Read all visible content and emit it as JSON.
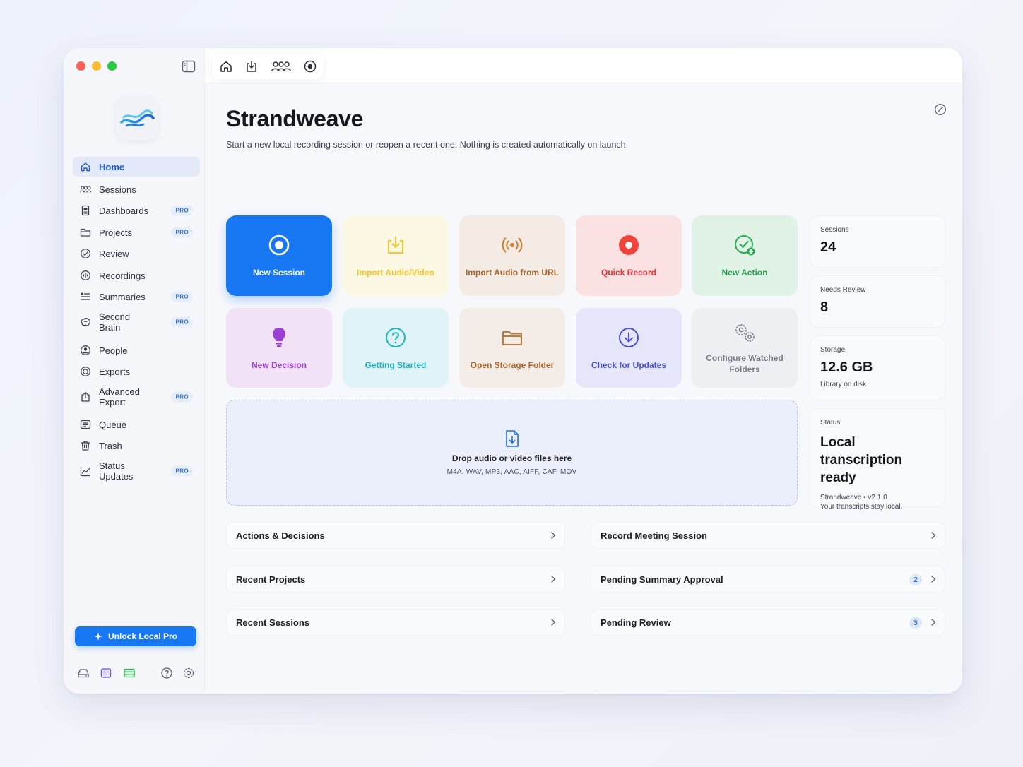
{
  "app": {
    "name": "Strandweave",
    "subtitle": "Start a new local recording session or reopen a recent one. Nothing is created automatically on launch."
  },
  "sidebar": {
    "items": [
      {
        "label": "Home",
        "icon": "home-icon",
        "active": true,
        "pro": false
      },
      {
        "label": "Sessions",
        "icon": "people-group-icon",
        "pro": false
      },
      {
        "label": "Dashboards",
        "icon": "dashboard-icon",
        "pro": true
      },
      {
        "label": "Projects",
        "icon": "folder-icon",
        "pro": true
      },
      {
        "label": "Review",
        "icon": "check-circle-icon",
        "pro": false
      },
      {
        "label": "Recordings",
        "icon": "waveform-icon",
        "pro": false
      },
      {
        "label": "Summaries",
        "icon": "list-icon",
        "pro": true
      },
      {
        "label": "Second Brain",
        "icon": "brain-icon",
        "pro": true
      },
      {
        "label": "People",
        "icon": "person-icon",
        "pro": false
      },
      {
        "label": "Exports",
        "icon": "export-circle-icon",
        "pro": false
      },
      {
        "label": "Advanced Export",
        "icon": "advanced-export-icon",
        "pro": true
      },
      {
        "label": "Queue",
        "icon": "queue-icon",
        "pro": false
      },
      {
        "label": "Trash",
        "icon": "trash-icon",
        "pro": false
      },
      {
        "label": "Status Updates",
        "icon": "chart-line-icon",
        "pro": true
      }
    ],
    "pro_badge": "PRO",
    "unlock_label": "Unlock Local Pro"
  },
  "tiles": [
    {
      "label": "New Session",
      "icon": "record-target-icon"
    },
    {
      "label": "Import Audio/Video",
      "icon": "import-icon"
    },
    {
      "label": "Import Audio from URL",
      "icon": "broadcast-icon"
    },
    {
      "label": "Quick Record",
      "icon": "record-dot-icon"
    },
    {
      "label": "New Action",
      "icon": "check-plus-icon"
    },
    {
      "label": "New Decision",
      "icon": "lightbulb-icon"
    },
    {
      "label": "Getting Started",
      "icon": "question-icon"
    },
    {
      "label": "Open Storage Folder",
      "icon": "folder-icon"
    },
    {
      "label": "Check for Updates",
      "icon": "download-circle-icon"
    },
    {
      "label": "Configure Watched Folders",
      "icon": "gears-icon"
    }
  ],
  "stats": {
    "sessions": {
      "label": "Sessions",
      "value": "24"
    },
    "review": {
      "label": "Needs Review",
      "value": "8"
    },
    "storage": {
      "label": "Storage",
      "value": "12.6 GB",
      "sub": "Library on disk"
    },
    "status": {
      "label": "Status",
      "value": "Local transcription ready",
      "version": "Strandweave • v2.1.0",
      "note": "Your transcripts stay local."
    }
  },
  "drop": {
    "title": "Drop audio or video files here",
    "formats": "M4A, WAV, MP3, AAC, AIFF, CAF, MOV"
  },
  "left_rows": [
    {
      "label": "Actions & Decisions"
    },
    {
      "label": "Recent Projects"
    },
    {
      "label": "Recent Sessions"
    }
  ],
  "right_rows": [
    {
      "label": "Record Meeting Session",
      "count": ""
    },
    {
      "label": "Pending Summary Approval",
      "count": "2"
    },
    {
      "label": "Pending Review",
      "count": "3"
    }
  ],
  "colors": {
    "accent": "#1877f2",
    "red": "#f0443a",
    "green": "#27b04f",
    "purple": "#9b3fd6",
    "teal": "#1fb6c9",
    "brown": "#a8642a",
    "indigo": "#4a50d8",
    "gray": "#7a7f8a"
  }
}
